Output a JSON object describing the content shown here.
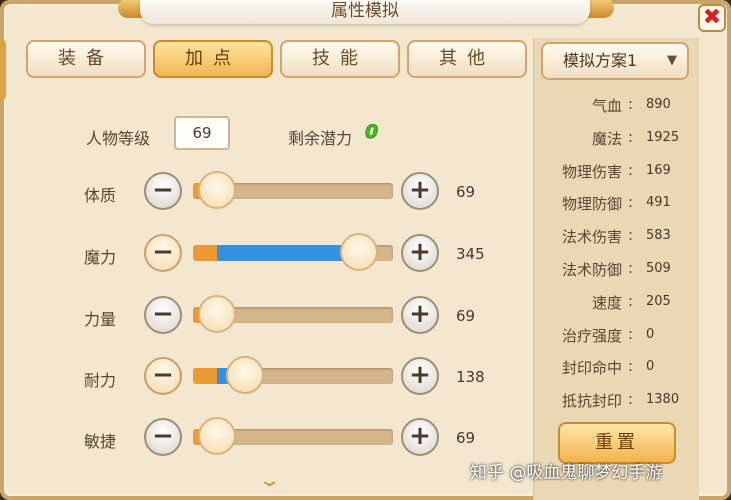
{
  "window": {
    "title": "属性模拟",
    "close_label": "✖"
  },
  "tabs": [
    "装备",
    "加点",
    "技能",
    "其他"
  ],
  "active_tab": 1,
  "level": {
    "label": "人物等级",
    "value": "69"
  },
  "potential": {
    "label": "剩余潜力",
    "value": "0"
  },
  "attributes": [
    {
      "label": "体质",
      "value": "69",
      "base_fraction": 0.12,
      "added_fraction": 0.0,
      "knob": 0.12,
      "minus_style": "gray"
    },
    {
      "label": "魔力",
      "value": "345",
      "base_fraction": 0.12,
      "added_fraction": 0.7,
      "knob": 0.83,
      "minus_style": "warm"
    },
    {
      "label": "力量",
      "value": "69",
      "base_fraction": 0.12,
      "added_fraction": 0.0,
      "knob": 0.12,
      "minus_style": "gray"
    },
    {
      "label": "耐力",
      "value": "138",
      "base_fraction": 0.12,
      "added_fraction": 0.13,
      "knob": 0.26,
      "minus_style": "warm"
    },
    {
      "label": "敏捷",
      "value": "69",
      "base_fraction": 0.12,
      "added_fraction": 0.0,
      "knob": 0.12,
      "minus_style": "gray"
    }
  ],
  "scheme": {
    "label": "模拟方案1"
  },
  "stats": [
    {
      "label": "气血",
      "value": "890"
    },
    {
      "label": "魔法",
      "value": "1925"
    },
    {
      "label": "物理伤害",
      "value": "169"
    },
    {
      "label": "物理防御",
      "value": "491"
    },
    {
      "label": "法术伤害",
      "value": "583"
    },
    {
      "label": "法术防御",
      "value": "509"
    },
    {
      "label": "速度",
      "value": "205"
    },
    {
      "label": "治疗强度",
      "value": "0"
    },
    {
      "label": "封印命中",
      "value": "0"
    },
    {
      "label": "抵抗封印",
      "value": "1380"
    }
  ],
  "stat_separator": ":",
  "reset_label": "重置",
  "watermark": "知乎 @吸血鬼聊梦幻手游",
  "colors": {
    "base_fill": "#ec9a33",
    "added_fill": "#3592e3",
    "potential_green": "#43c21c"
  }
}
